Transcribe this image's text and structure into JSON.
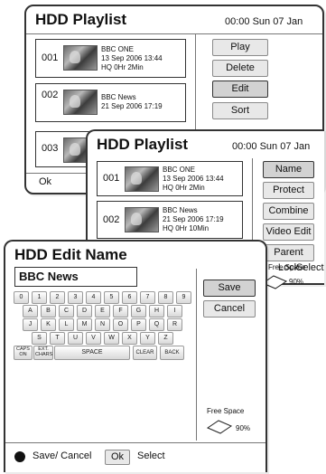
{
  "screen1": {
    "title": "HDD Playlist",
    "clock": "00:00 Sun 07 Jan",
    "items": [
      {
        "num": "001",
        "line1": "BBC ONE",
        "line2": "13 Sep 2006 13:44",
        "line3": "HQ  0Hr  2Min"
      },
      {
        "num": "002",
        "line1": "BBC News",
        "line2": "21 Sep 2006 17:19",
        "line3": ""
      },
      {
        "num": "003",
        "line1": "",
        "line2": "",
        "line3": ""
      }
    ],
    "menu": [
      "Play",
      "Delete",
      "Edit",
      "Sort"
    ],
    "footer_ok": "Ok"
  },
  "screen2": {
    "title": "HDD Playlist",
    "clock": "00:00 Sun 07 Jan",
    "items": [
      {
        "num": "001",
        "line1": "BBC ONE",
        "line2": "13 Sep 2006 13:44",
        "line3": "HQ  0Hr  2Min"
      },
      {
        "num": "002",
        "line1": "BBC News",
        "line2": "21 Sep 2006 17:19",
        "line3": "HQ  0Hr  10Min"
      }
    ],
    "menu": [
      "Name",
      "Protect",
      "Combine",
      "Video Edit",
      "Parent Lock"
    ],
    "free_space_label": "Free Space",
    "free_space_value": "90%",
    "footer_select": "Select"
  },
  "screen3": {
    "title": "HDD Edit Name",
    "name_value": "BBC News",
    "save_label": "Save",
    "cancel_label": "Cancel",
    "free_space_label": "Free Space",
    "free_space_value": "90%",
    "footer_save_cancel": "Save/ Cancel",
    "footer_ok": "Ok",
    "footer_select": "Select",
    "keyboard": {
      "row1": [
        "0",
        "1",
        "2",
        "3",
        "4",
        "5",
        "6",
        "7",
        "8",
        "9"
      ],
      "row2": [
        "A",
        "B",
        "C",
        "D",
        "E",
        "F",
        "G",
        "H",
        "I"
      ],
      "row3": [
        "J",
        "K",
        "L",
        "M",
        "N",
        "O",
        "P",
        "Q",
        "R"
      ],
      "row4": [
        "S",
        "T",
        "U",
        "V",
        "W",
        "X",
        "Y",
        "Z"
      ],
      "caps_on": "CAPS ON",
      "ext_chars": "EXT. CHARS",
      "space": "SPACE",
      "clear": "CLEAR",
      "back": "BACK"
    }
  }
}
